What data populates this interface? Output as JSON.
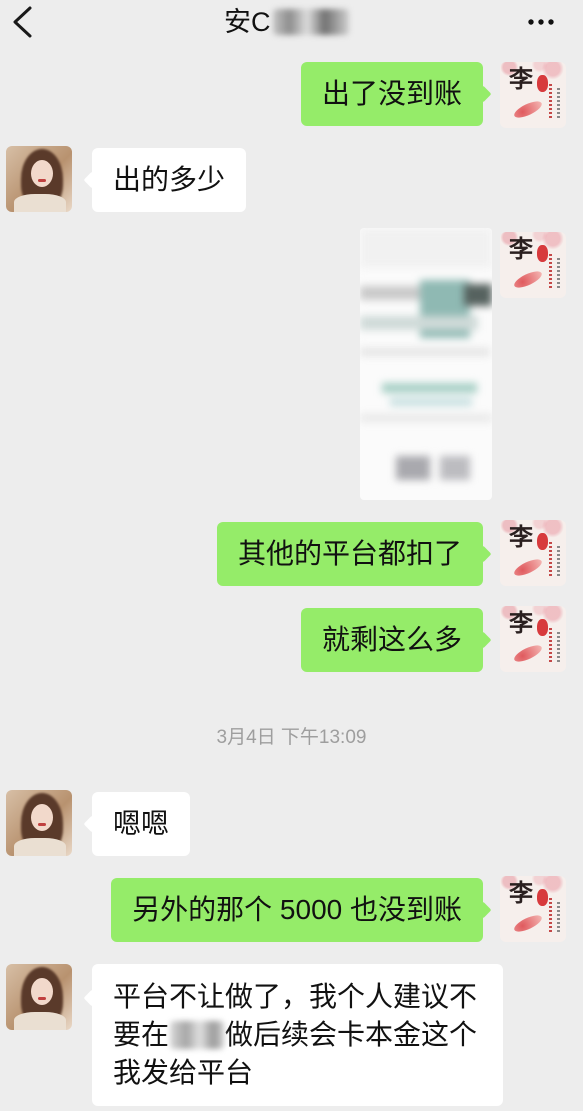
{
  "header": {
    "title": "安C",
    "back_icon": "chevron-left-icon",
    "more_icon": "ellipsis-icon"
  },
  "colors": {
    "background": "#ededed",
    "outgoing_bubble": "#95ec69",
    "incoming_bubble": "#ffffff",
    "timestamp": "#9e9e9e"
  },
  "avatars": {
    "me": {
      "glyph": "李"
    }
  },
  "messages": [
    {
      "outgoing": true,
      "text": "出了没到账"
    },
    {
      "outgoing": false,
      "text": "出的多少"
    },
    {
      "outgoing": true,
      "image": true
    },
    {
      "outgoing": true,
      "text": "其他的平台都扣了"
    },
    {
      "outgoing": true,
      "text": "就剩这么多"
    },
    {
      "timestamp": "3月4日 下午13:09"
    },
    {
      "outgoing": false,
      "text": "嗯嗯"
    },
    {
      "outgoing": true,
      "text": "另外的那个 5000 也没到账"
    },
    {
      "outgoing": false,
      "line1": "平台不让做了，我个人建议不",
      "line2_before_redaction": "要在",
      "line2_after_redaction": "做后续会卡本金这个",
      "line3": "我发给平台"
    }
  ]
}
